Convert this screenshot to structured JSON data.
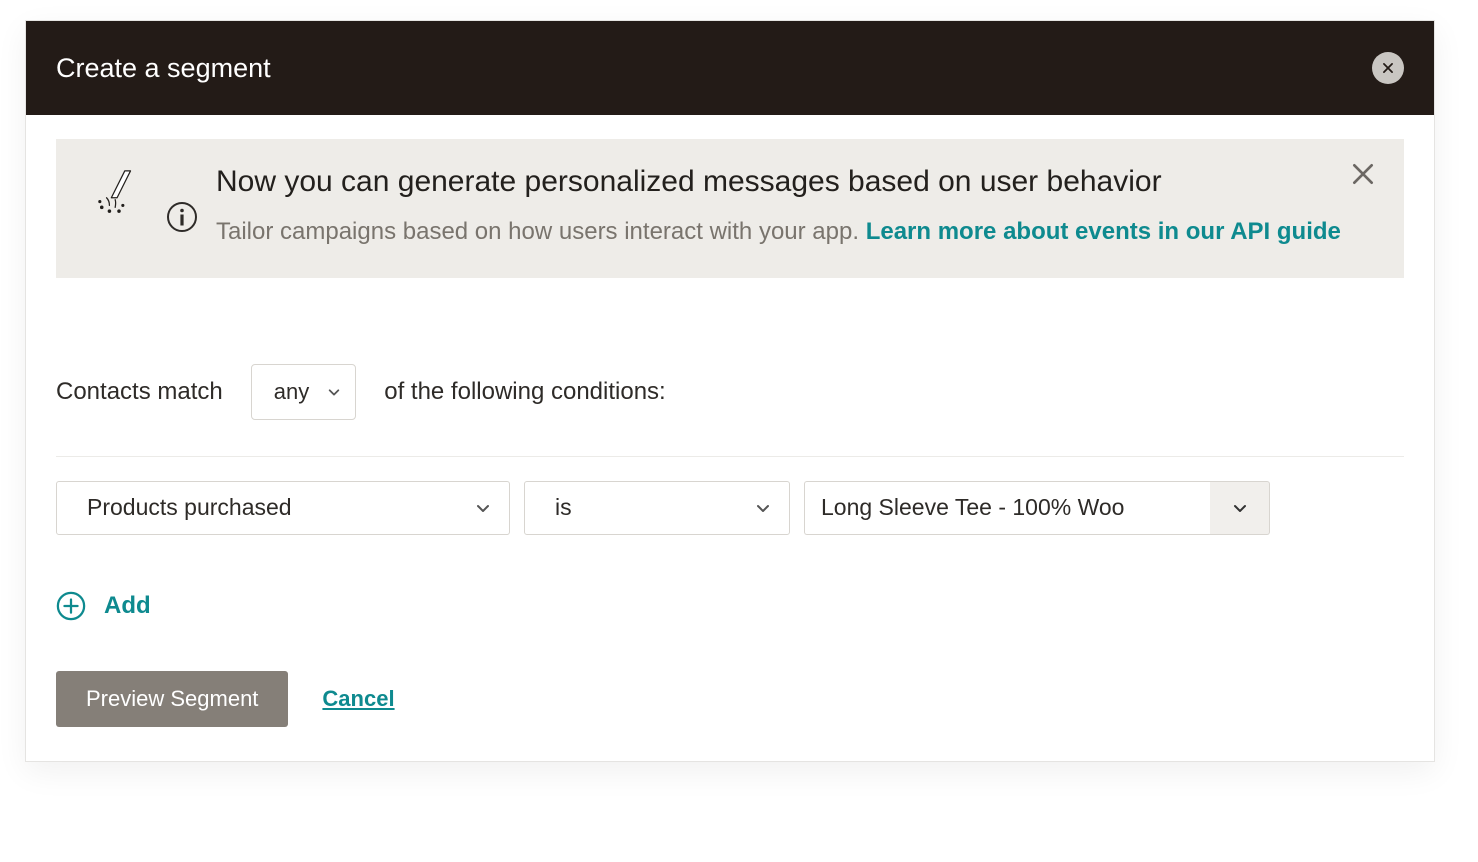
{
  "modal": {
    "title": "Create a segment"
  },
  "banner": {
    "heading": "Now you can generate personalized messages based on user behavior",
    "sub_prefix": "Tailor campaigns based on how users interact with your app. ",
    "link_text": "Learn more about events in our API guide"
  },
  "match": {
    "prefix": "Contacts match",
    "selector_value": "any",
    "suffix": "of the following conditions:"
  },
  "condition": {
    "field": "Products purchased",
    "operator": "is",
    "value": "Long Sleeve Tee - 100% Woo"
  },
  "add_label": "Add",
  "buttons": {
    "preview": "Preview Segment",
    "cancel": "Cancel"
  }
}
